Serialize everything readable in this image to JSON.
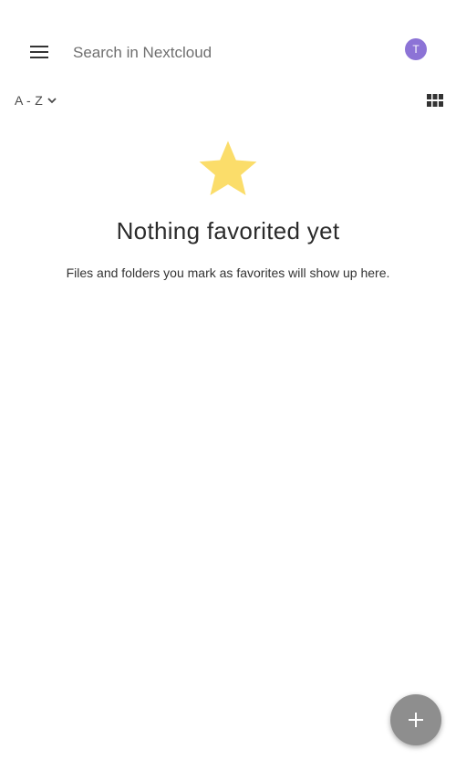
{
  "header": {
    "search_placeholder": "Search in Nextcloud",
    "avatar_initial": "T",
    "avatar_color": "#8c73d6"
  },
  "toolbar": {
    "sort_label": "A - Z",
    "sort_icon": "chevron-down-icon",
    "view_toggle_icon": "grid-view-icon"
  },
  "empty_state": {
    "icon": "star-icon",
    "icon_color": "#fbdd6a",
    "title": "Nothing favorited yet",
    "message": "Files and folders you mark as favorites will show up here."
  },
  "fab": {
    "icon": "plus-icon",
    "color": "#8e8e8e"
  }
}
